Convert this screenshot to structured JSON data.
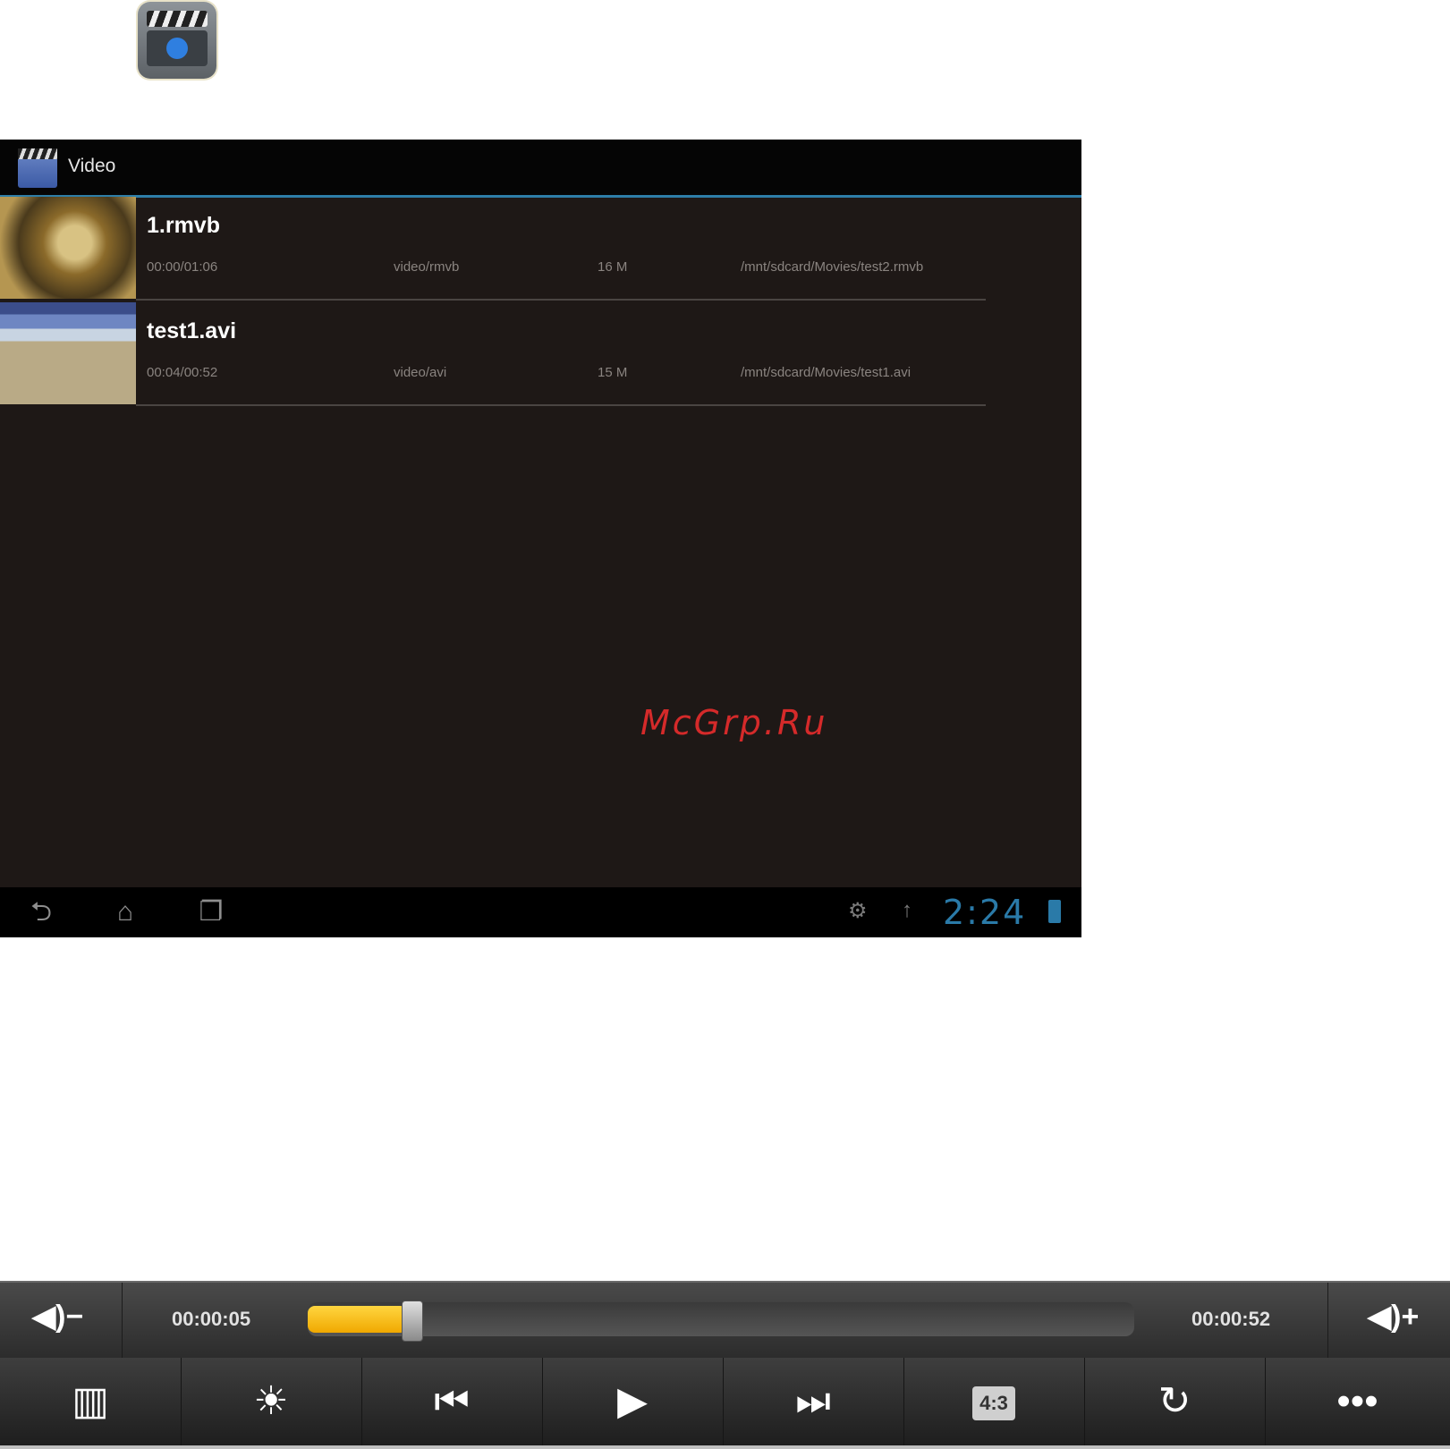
{
  "screen": {
    "title": "Video",
    "videos": [
      {
        "name": "1.rmvb",
        "duration": "00:00/01:06",
        "type": "video/rmvb",
        "size": "16 M",
        "path": "/mnt/sdcard/Movies/test2.rmvb"
      },
      {
        "name": "test1.avi",
        "duration": "00:04/00:52",
        "type": "video/avi",
        "size": "15 M",
        "path": "/mnt/sdcard/Movies/test1.avi"
      }
    ],
    "watermark": "McGrp.Ru",
    "clock": "2:24"
  },
  "player": {
    "current_time": "00:00:05",
    "total_time": "00:00:52",
    "progress_fraction": 0.12,
    "volume_down_label": "◀)−",
    "volume_up_label": "◀)+",
    "aspect_label": "4:3"
  },
  "icons": {
    "app": "clapperboard-icon",
    "back": "back-icon",
    "home": "home-icon",
    "recent": "recent-apps-icon",
    "settings": "settings-icon",
    "usb": "usb-icon",
    "battery": "battery-icon",
    "playlist": "playlist-icon",
    "brightness": "brightness-icon",
    "prev": "previous-icon",
    "play": "play-icon",
    "next": "next-icon",
    "repeat": "repeat-icon",
    "more": "more-icon"
  },
  "colors": {
    "accent": "#2e7ea8",
    "progress": "#f0b400",
    "watermark": "#d52a2a"
  }
}
